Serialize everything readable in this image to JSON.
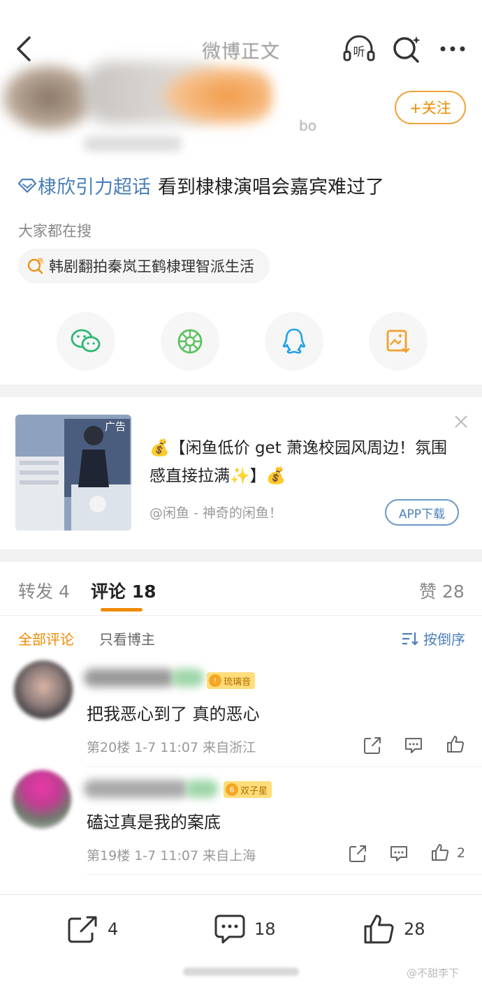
{
  "header": {
    "title": "微博正文",
    "listen_label": "听"
  },
  "author": {
    "name_fragment": "bo",
    "follow_label": "+关注"
  },
  "post": {
    "topic": "棣欣引力超话",
    "text": "看到棣棣演唱会嘉宾难过了"
  },
  "trending": {
    "label": "大家都在搜",
    "hot_badge": "热",
    "query": "韩剧翻拍秦岚王鹤棣理智派生活"
  },
  "share": {
    "items": [
      "wechat-icon",
      "moments-icon",
      "qq-icon",
      "save-image-icon"
    ]
  },
  "ad": {
    "tag": "广告",
    "title": "💰【闲鱼低价 get 萧逸校园风周边！氛围感直接拉满✨】💰",
    "source": "@闲鱼 - 神奇的闲鱼！",
    "button": "APP下载"
  },
  "tabs": {
    "repost": "转发 4",
    "comments": "评论 18",
    "likes": "赞 28"
  },
  "filters": {
    "all": "全部评论",
    "owner_only": "只看博主",
    "sort": "按倒序"
  },
  "comments": [
    {
      "badge": "琉璃音",
      "badge_level": "!",
      "text": "把我恶心到了 真的恶心",
      "meta": "第20楼 1-7 11:07 来自浙江",
      "likes": ""
    },
    {
      "badge": "双子星",
      "badge_level": "6",
      "text": "磕过真是我的案底",
      "meta": "第19楼 1-7 11:07 来自上海",
      "likes": "2"
    }
  ],
  "bottom_bar": {
    "repost_count": "4",
    "comment_count": "18",
    "like_count": "28"
  },
  "watermark": "@不甜李下",
  "colors": {
    "accent": "#f08a00",
    "link": "#4a7fb8",
    "wechat": "#2bb673",
    "moments": "#5cc160",
    "qq": "#1ea1e6",
    "save": "#f0a030"
  }
}
